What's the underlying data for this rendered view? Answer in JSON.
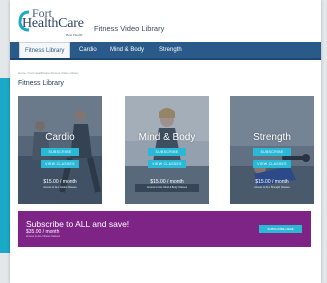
{
  "header": {
    "logo_top": "Fort",
    "logo_main": "HealthCare",
    "logo_tag": "Best Health",
    "site_title": "Fitness Video Library"
  },
  "nav": {
    "items": [
      {
        "label": "Fitness Library",
        "active": true
      },
      {
        "label": "Cardio",
        "active": false
      },
      {
        "label": "Mind & Body",
        "active": false
      },
      {
        "label": "Strength",
        "active": false
      }
    ]
  },
  "breadcrumb": "Home / Fort HealthCare Fitness Video Library",
  "page_title": "Fitness Library",
  "cards": [
    {
      "title": "Cardio",
      "subscribe_label": "SUBSCRIBE",
      "classes_label": "VIEW CLASSES",
      "price": "$15.00 / month",
      "note": "Access to ALL Cardio Classes"
    },
    {
      "title": "Mind & Body",
      "subscribe_label": "SUBSCRIBE",
      "classes_label": "VIEW CLASSES",
      "price": "$15.00 / month",
      "note": "Access to ALL Mind & Body Classes"
    },
    {
      "title": "Strength",
      "subscribe_label": "SUBSCRIBE",
      "classes_label": "VIEW CLASSES",
      "price": "$15.00 / month",
      "note": "Access to ALL Strength Classes"
    }
  ],
  "promo": {
    "headline": "Subscribe to ALL and save!",
    "price": "$35.00 / month",
    "note": "Access to ALL Fitness Classes",
    "button_label": "SUBSCRIBE HERE"
  },
  "colors": {
    "brand_blue": "#2a5a8a",
    "accent_teal": "#1aa9c6",
    "button_cyan": "#2bb8d6",
    "promo_purple": "#7e2487"
  }
}
